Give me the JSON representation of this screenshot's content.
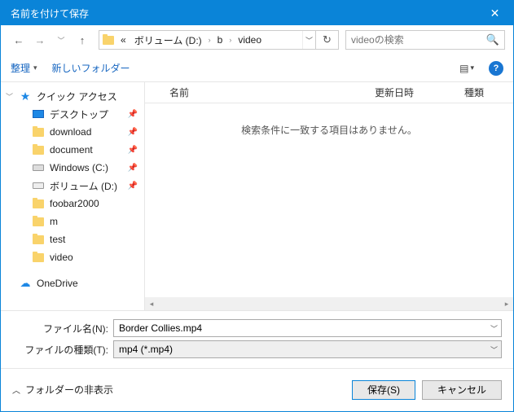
{
  "window": {
    "title": "名前を付けて保存"
  },
  "breadcrumb": {
    "prefix": "«",
    "parts": [
      "ボリューム (D:)",
      "b",
      "video"
    ]
  },
  "search": {
    "placeholder": "videoの検索"
  },
  "toolbar": {
    "organize": "整理",
    "new_folder": "新しいフォルダー"
  },
  "columns": {
    "name": "名前",
    "date": "更新日時",
    "type": "種類"
  },
  "empty_text": "検索条件に一致する項目はありません。",
  "sidebar": {
    "quick_access": "クイック アクセス",
    "items": [
      {
        "label": "デスクトップ",
        "icon": "desktop",
        "pinned": true
      },
      {
        "label": "download",
        "icon": "folder",
        "pinned": true
      },
      {
        "label": "document",
        "icon": "folder",
        "pinned": true
      },
      {
        "label": "Windows (C:)",
        "icon": "drive",
        "pinned": true
      },
      {
        "label": "ボリューム (D:)",
        "icon": "volume",
        "pinned": true
      },
      {
        "label": "foobar2000",
        "icon": "folder",
        "pinned": false
      },
      {
        "label": "m",
        "icon": "folder",
        "pinned": false
      },
      {
        "label": "test",
        "icon": "folder",
        "pinned": false
      },
      {
        "label": "video",
        "icon": "folder",
        "pinned": false
      }
    ],
    "onedrive": "OneDrive"
  },
  "form": {
    "filename_label": "ファイル名(N):",
    "filename_value": "Border Collies.mp4",
    "filetype_label": "ファイルの種類(T):",
    "filetype_value": "mp4 (*.mp4)"
  },
  "bottom": {
    "hide_folders": "フォルダーの非表示",
    "save": "保存(S)",
    "cancel": "キャンセル"
  }
}
